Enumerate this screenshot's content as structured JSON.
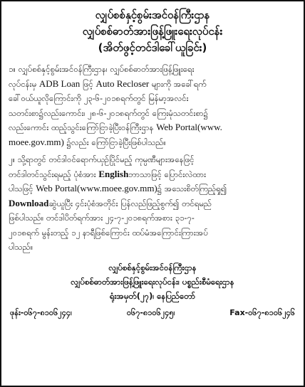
{
  "header": {
    "ministry": "လျှပ်စစ်နှင့်စွမ်းအင်ဝန်ကြီးဌာန",
    "department": "လျှပ်စစ်ဓာတ်အားဖြန့်ဖြူးရေးလုပ်ငန်း",
    "title": "(အိတ်ဖွင့်တင်ဒါခေါ်ယူခြင်း)"
  },
  "para1": {
    "l1": "၁။   လျှပ်စစ်နှင့်စွမ်းအင်ဝန်ကြီးဌာန၊ လျှပ်စစ်ဓာတ်အားဖြန့်ဖြူးရေး",
    "l2a": "လုပ်ငန်းမှ ",
    "l2b": "ADB Loan",
    "l2c": " ဖြင့် ",
    "l2d": "Auto Recloser",
    "l2e": " များကို အခေါ်ရက်",
    "l3": "ခေါ်ဝယ်ယူလိုကြောင်းကို ၂၃-၆-၂၀၁၈ရက်တွင် မြန်မာ့အလင်း",
    "l4": "သတင်းစာ၌လည်းကောင်း၊ ၂၈-၆-၂၀၁၈ရက်တွင် ကြေးမုံသတင်းစာ၌",
    "l5a": "လည်းကောင်း ထည့်သွင်းကြော်ငြာခဲ့ပြီးဝန်ကြီးဌာန ",
    "l5b": "Web Portal(www.",
    "l6a": "moee.gov.mm)",
    "l6b": " ၌လည်း ကြော်ငြာခဲ့ပြီးဖြစ်ပါသည်။"
  },
  "para2": {
    "l1": "၂။   သို့ရာတွင် တင်ဒါဝင်ရောက်ယှဉ်ပြိုင်မည့် ကုမ္ပဏီများအနေဖြင့်",
    "l2a": "တင်ဒါတင်သွင်းရမည့် ပုံစံအား ",
    "l2b": "English",
    "l2c": "ဘာသာဖြင့် ပြောင်းလဲထား",
    "l3a": "ပါသဖြင့် ",
    "l3b": "Web Portal(www.moee.gov.mm)",
    "l3c": "၌  အသေးစိတ်ကြည့်ရှု၍",
    "l4a": "Download",
    "l4b": "ဆွဲယူပြီး ၄င်းပုံစံအတိုင်း ပြန်လည်ဖြည့်စွက်၍ တင်ရမည်",
    "l5": "ဖြစ်ပါသည်။ တင်ဒါပိတ်ရက်အား ၂၄-၇-၂၀၁၈ရက်အစား ၃၁-၇-",
    "l6": "၂၀၁၈ရက် မွန်းတည့် ၁၂ နာရီဖြစ်ကြောင်း ထပ်မံအကြောင်းကြားအပ်",
    "l7": "ပါသည်။"
  },
  "footer": {
    "ministry": "လျှပ်စစ်နှင့်စွမ်းအင်ဝန်ကြီးဌာန",
    "department": "လျှပ်စစ်ဓာတ်အားဖြန့်ဖြူးရေးလုပ်ငန်း၊ ပစ္စည်းစီမံရေးဌာန",
    "address": "ရုံးအမှတ်(၂၇)၊ နေပြည်တော်",
    "phone1": "ဖုန်း-၀၆၇-၈၁၀၆၂၄၄၊",
    "phone2": "၀၆၇-၈၁၀၆၂၄၅၊",
    "fax": "Fax-၀၆၇-၈၁၀၆၂၄၆"
  }
}
